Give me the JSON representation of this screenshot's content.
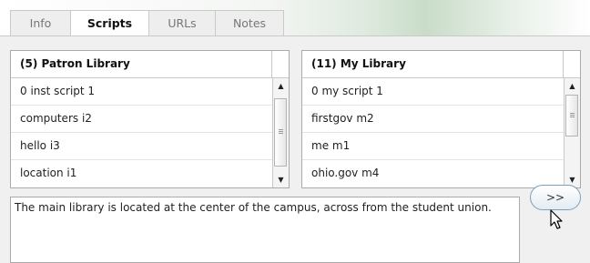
{
  "tabs": [
    {
      "label": "Info"
    },
    {
      "label": "Scripts"
    },
    {
      "label": "URLs"
    },
    {
      "label": "Notes"
    }
  ],
  "active_tab": "Scripts",
  "patron_library": {
    "title": "(5) Patron Library",
    "items": [
      "0 inst script 1",
      "computers i2",
      "hello i3",
      "location i1"
    ]
  },
  "my_library": {
    "title": "(11) My Library",
    "items": [
      "0 my script 1",
      "firstgov m2",
      "me m1",
      "ohio.gov m4"
    ]
  },
  "note": {
    "text": "The main library is located at the center of the campus, across from the student union."
  },
  "transfer_button": {
    "label": ">>"
  },
  "icons": {
    "scroll_up": "arrow-up-icon",
    "scroll_down": "arrow-down-icon",
    "pointer": "mouse-cursor-icon"
  }
}
